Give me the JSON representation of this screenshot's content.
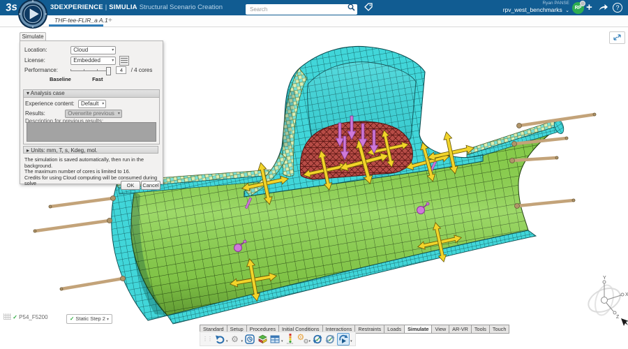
{
  "colors": {
    "topbar": "#115C92",
    "accent": "#2E7CB8",
    "mesh_green": "#8CD24E",
    "mesh_cyan": "#41D6D9",
    "mesh_pale": "#DCEDB2",
    "mesh_red": "#C9564F",
    "arrow_yellow": "#F2D42A",
    "magenta": "#CE79D9",
    "rod_tan": "#C3A379",
    "avatar_green": "#2EAD52"
  },
  "topbar": {
    "brand": "3DEXPERIENCE",
    "divider": "|",
    "product": "SIMULIA",
    "module": "Structural Scenario Creation",
    "search_placeholder": "Search",
    "user_name": "Ryan PANSE",
    "workspace": "rpv_west_benchmarks",
    "workspace_caret": "⌄",
    "avatar_initials": "RP",
    "add_label": "+",
    "help_label": "?"
  },
  "tabbar": {
    "document_tab": "THF-tee-FLIR_a A.1",
    "new_tab": "+"
  },
  "dialog": {
    "tab": "Simulate",
    "location_label": "Location:",
    "location_value": "Cloud",
    "license_label": "License:",
    "license_value": "Embedded",
    "performance_label": "Performance:",
    "cores_value": "4",
    "cores_suffix": "/ 4 cores",
    "slider_min_label": "Baseline",
    "slider_max_label": "Fast",
    "analysis_case_header": "Analysis case",
    "collapse_caret": "▾",
    "expand_caret": "▸",
    "experience_content_label": "Experience content:",
    "experience_content_value": "Default",
    "results_label": "Results:",
    "results_value": "Overwrite previous",
    "description_label": "Description for previous results:",
    "units_header": "Units: mm, T, s, Kdeg, mol.",
    "info_lines": [
      "The simulation is saved automatically, then run in the background.",
      "The maximum number of cores is limited to 16.",
      "Credits for using Cloud computing will be consumed during solve"
    ],
    "ok_label": "OK",
    "cancel_label": "Cancel"
  },
  "viewport": {
    "mesh_badge": "P54_F5200",
    "step_badge": "Static Step 2",
    "check_glyph": "✓",
    "compass": {
      "x": "X",
      "y": "Y",
      "z": "Z"
    }
  },
  "action_bar": {
    "tabs": [
      {
        "label": "Standard"
      },
      {
        "label": "Setup"
      },
      {
        "label": "Procedures"
      },
      {
        "label": "Initial Conditions"
      },
      {
        "label": "Interactions"
      },
      {
        "label": "Restraints"
      },
      {
        "label": "Loads"
      },
      {
        "label": "Simulate"
      },
      {
        "label": "View"
      },
      {
        "label": "AR-VR"
      },
      {
        "label": "Tools"
      },
      {
        "label": "Touch"
      }
    ],
    "icons": [
      "undo",
      "part-history",
      "model-update",
      "results-layers",
      "data-table",
      "plot-results",
      "solver-gears",
      "model-check",
      "scenario-check",
      "simulate-run"
    ]
  }
}
